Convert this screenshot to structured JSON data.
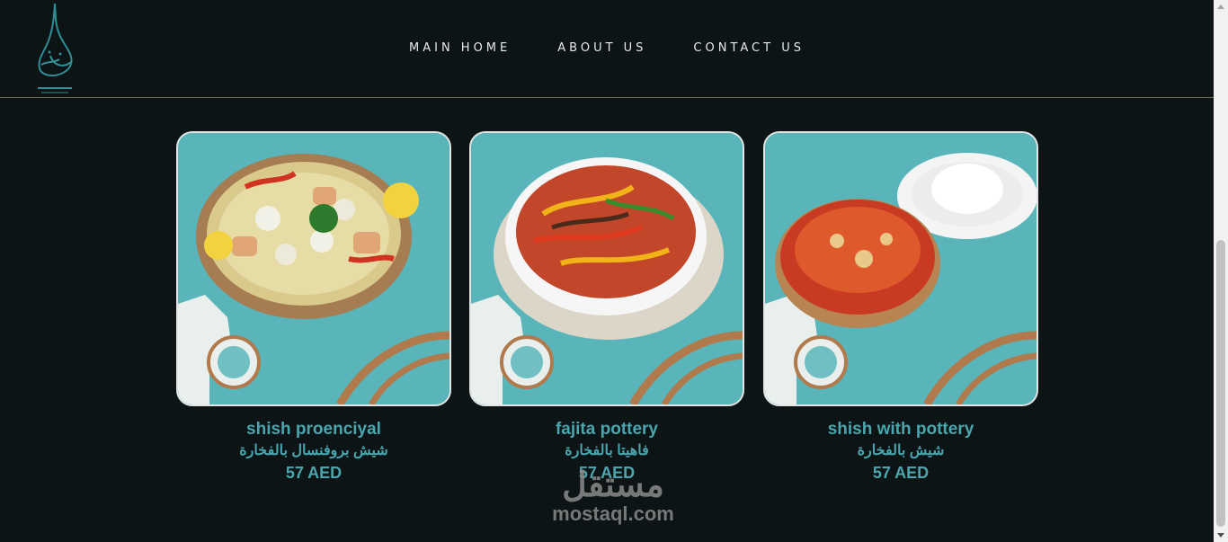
{
  "logo": {
    "icon": "restaurant-logo",
    "ar_text": "مطعم وكافيه",
    "en_text": "Restaurant & Cafe"
  },
  "nav": [
    {
      "label": "MAIN HOME"
    },
    {
      "label": "ABOUT US"
    },
    {
      "label": "CONTACT US"
    }
  ],
  "menu_items": [
    {
      "name": "shish proenciyal",
      "name_ar": "شيش بروفنسال بالفخارة",
      "price": "57 AED"
    },
    {
      "name": "fajita pottery",
      "name_ar": "فاهيتا بالفخارة",
      "price": "57 AED"
    },
    {
      "name": "shish with pottery",
      "name_ar": "شيش بالفخارة",
      "price": "57 AED"
    }
  ],
  "watermark": {
    "ar": "مستقل",
    "en": "mostaql.com"
  },
  "colors": {
    "background": "#0d1416",
    "accent": "#4aa5ad",
    "card_bg": "#5ab5ba",
    "divider": "#6e6a55"
  }
}
